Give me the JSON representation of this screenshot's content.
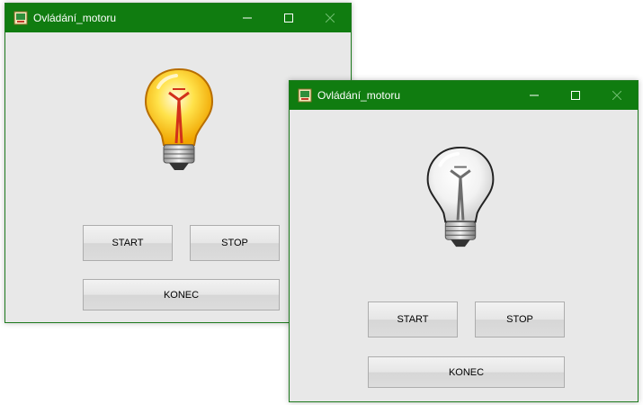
{
  "windows": [
    {
      "title": "Ovládání_motoru",
      "bulb_state": "on",
      "buttons": {
        "start": "START",
        "stop": "STOP",
        "konec": "KONEC"
      }
    },
    {
      "title": "Ovládání_motoru",
      "bulb_state": "off",
      "buttons": {
        "start": "START",
        "stop": "STOP",
        "konec": "KONEC"
      }
    }
  ],
  "colors": {
    "titlebar": "#107c10",
    "window_bg": "#e8e8e8",
    "bulb_on": "#ffd21a",
    "bulb_off": "#f4f4f4"
  },
  "icons": [
    "app-icon",
    "minimize-icon",
    "maximize-icon",
    "close-icon",
    "light-bulb-on-icon",
    "light-bulb-off-icon"
  ]
}
